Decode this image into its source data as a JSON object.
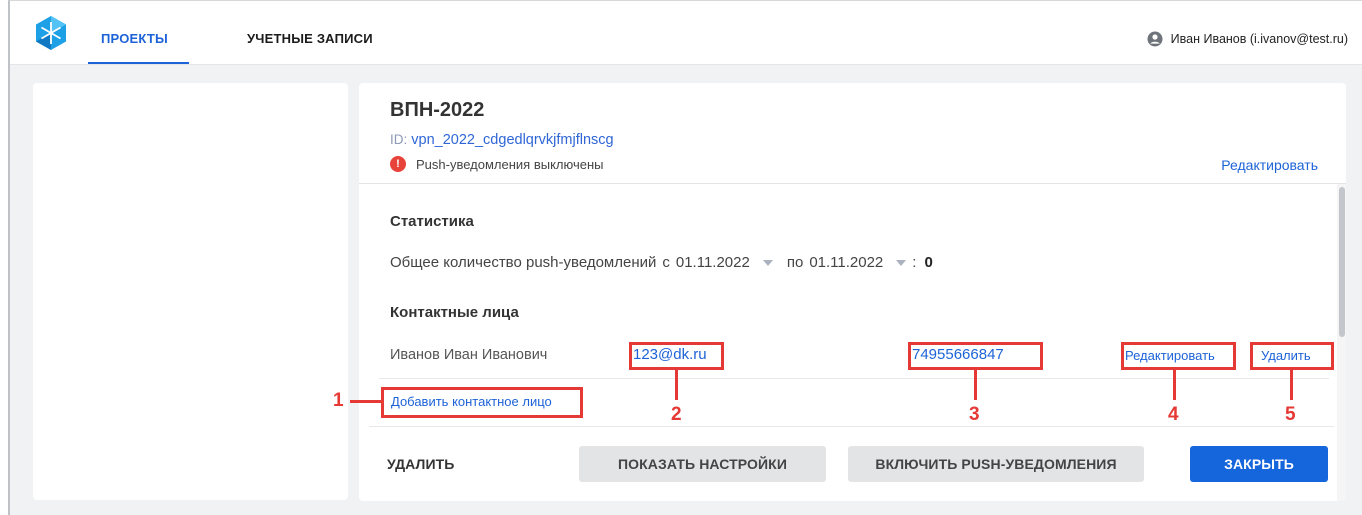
{
  "header": {
    "tabs": [
      {
        "label": "ПРОЕКТЫ",
        "active": true
      },
      {
        "label": "УЧЕТНЫЕ ЗАПИСИ",
        "active": false
      }
    ],
    "user": "Иван Иванов (i.ivanov@test.ru)"
  },
  "project": {
    "title": "ВПН-2022",
    "id_label": "ID:",
    "id_value": "vpn_2022_cdgedlqrvkjfmjflnscg",
    "push_status": "Push-уведомления выключены",
    "edit_label": "Редактировать"
  },
  "stats": {
    "title": "Статистика",
    "total_label": "Общее количество push-уведомлений",
    "from_label": "с",
    "from_date": "01.11.2022",
    "to_label": "по",
    "to_date": "01.11.2022",
    "colon": ":",
    "count": "0"
  },
  "contacts": {
    "title": "Контактные лица",
    "items": [
      {
        "name": "Иванов Иван Иванович",
        "email": "123@dk.ru",
        "phone": "74955666847",
        "edit_label": "Редактировать",
        "delete_label": "Удалить"
      }
    ],
    "add_label": "Добавить контактное лицо"
  },
  "footer": {
    "delete_label": "УДАЛИТЬ",
    "settings_label": "ПОКАЗАТЬ НАСТРОЙКИ",
    "push_label": "ВКЛЮЧИТЬ PUSH-УВЕДОМЛЕНИЯ",
    "close_label": "ЗАКРЫТЬ"
  },
  "annotations": [
    "1",
    "2",
    "3",
    "4",
    "5"
  ],
  "colors": {
    "accent": "#1d63d8",
    "primary_button": "#1565dc",
    "annotation": "#e53935",
    "warning": "#e8433a"
  }
}
